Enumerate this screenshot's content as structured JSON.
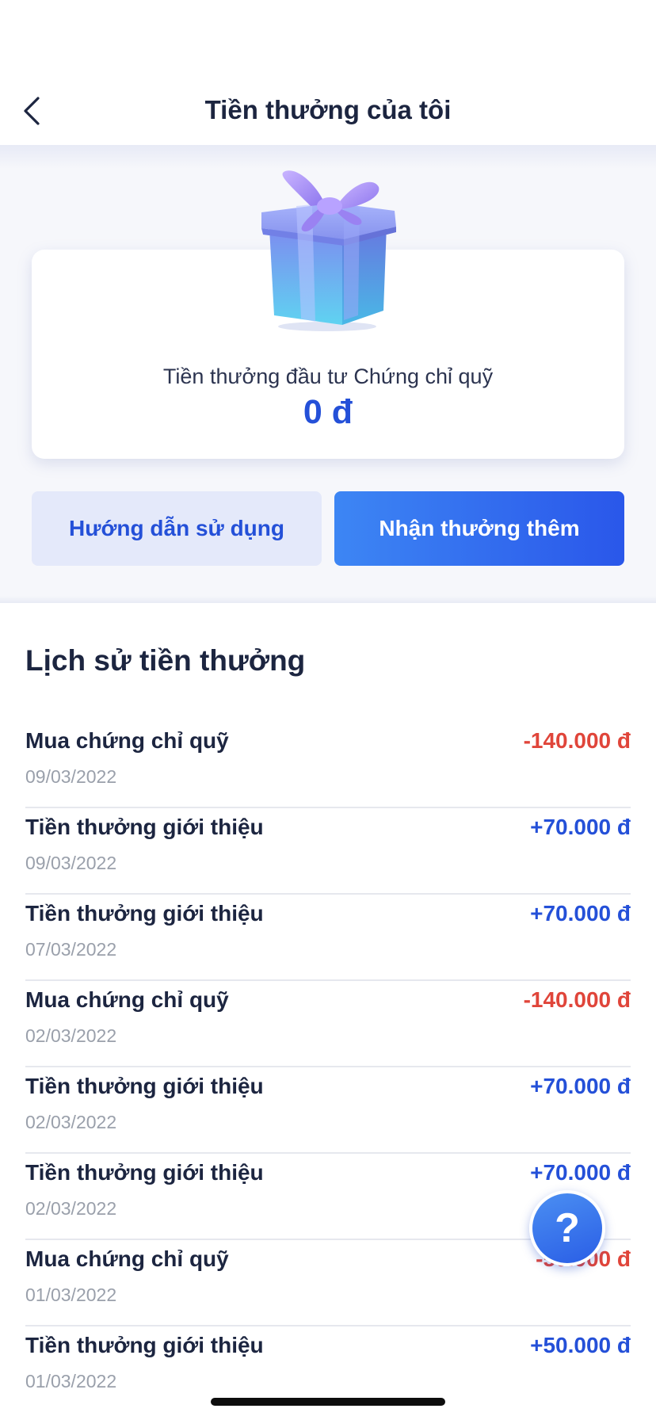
{
  "header": {
    "title": "Tiền thưởng của tôi",
    "back_icon": "chevron-left-icon"
  },
  "bonus_card": {
    "icon": "gift-box-icon",
    "label": "Tiền thưởng đầu tư Chứng chỉ quỹ",
    "amount": "0 đ"
  },
  "actions": {
    "guide_label": "Hướng dẫn sử dụng",
    "more_label": "Nhận thưởng thêm"
  },
  "history": {
    "title": "Lịch sử tiền thưởng",
    "items": [
      {
        "name": "Mua chứng chỉ quỹ",
        "date": "09/03/2022",
        "amount": "-140.000 đ",
        "type": "neg"
      },
      {
        "name": "Tiền thưởng giới thiệu",
        "date": "09/03/2022",
        "amount": "+70.000 đ",
        "type": "pos"
      },
      {
        "name": "Tiền thưởng giới thiệu",
        "date": "07/03/2022",
        "amount": "+70.000 đ",
        "type": "pos"
      },
      {
        "name": "Mua chứng chỉ quỹ",
        "date": "02/03/2022",
        "amount": "-140.000 đ",
        "type": "neg"
      },
      {
        "name": "Tiền thưởng giới thiệu",
        "date": "02/03/2022",
        "amount": "+70.000 đ",
        "type": "pos"
      },
      {
        "name": "Tiền thưởng giới thiệu",
        "date": "02/03/2022",
        "amount": "+70.000 đ",
        "type": "pos"
      },
      {
        "name": "Mua chứng chỉ quỹ",
        "date": "01/03/2022",
        "amount": "-50.000 đ",
        "type": "neg"
      },
      {
        "name": "Tiền thưởng giới thiệu",
        "date": "01/03/2022",
        "amount": "+50.000 đ",
        "type": "pos"
      }
    ]
  },
  "help": {
    "icon": "question-icon",
    "symbol": "?"
  },
  "colors": {
    "accent": "#2450d8",
    "negative": "#e0453a",
    "positive": "#2450d8"
  }
}
